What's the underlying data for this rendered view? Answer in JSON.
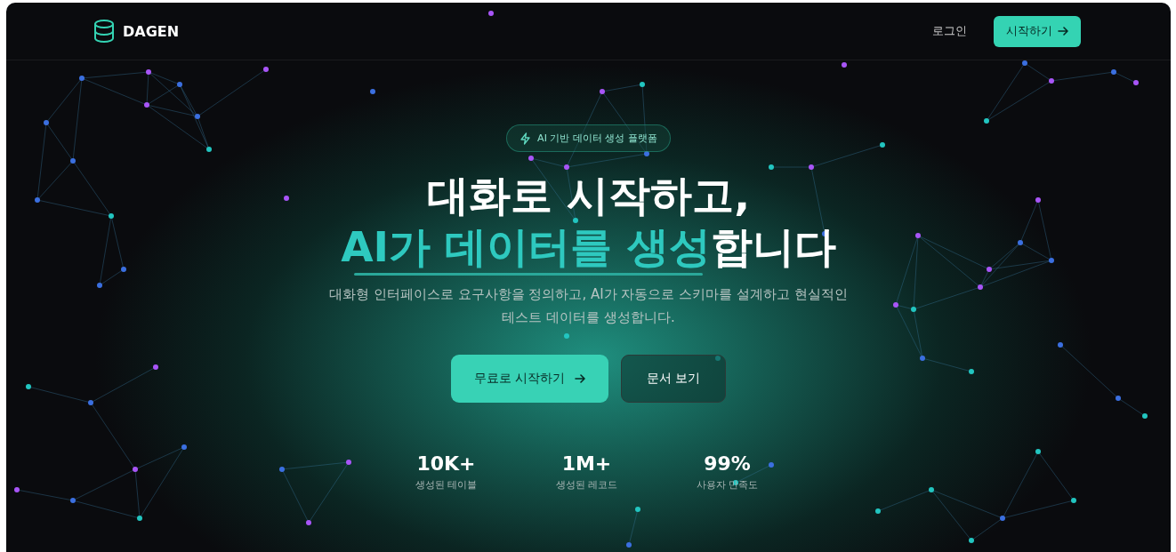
{
  "nav": {
    "brand": "DAGEN",
    "login": "로그인",
    "cta": "시작하기"
  },
  "hero": {
    "badge": "AI 기반 데이터 생성 플랫폼",
    "headline_1": "대화로 시작하고,",
    "headline_2": [
      {
        "text": "AI가 데이터를 생성",
        "accent": true
      },
      {
        "text": "합니다",
        "accent": false
      }
    ],
    "description": "대화형 인터페이스로 요구사항을 정의하고, AI가 자동으로 스키마를 설계하고 현실적인 테스트 데이터를 생성합니다.",
    "buttons": [
      {
        "label": "무료로 시작하기",
        "kind": "primary"
      },
      {
        "label": "문서 보기",
        "kind": "outline"
      }
    ],
    "stats": [
      {
        "value": "10K+",
        "label": "생성된 테이블"
      },
      {
        "value": "1M+",
        "label": "생성된 레코드"
      },
      {
        "value": "99%",
        "label": "사용자 만족도"
      }
    ]
  }
}
